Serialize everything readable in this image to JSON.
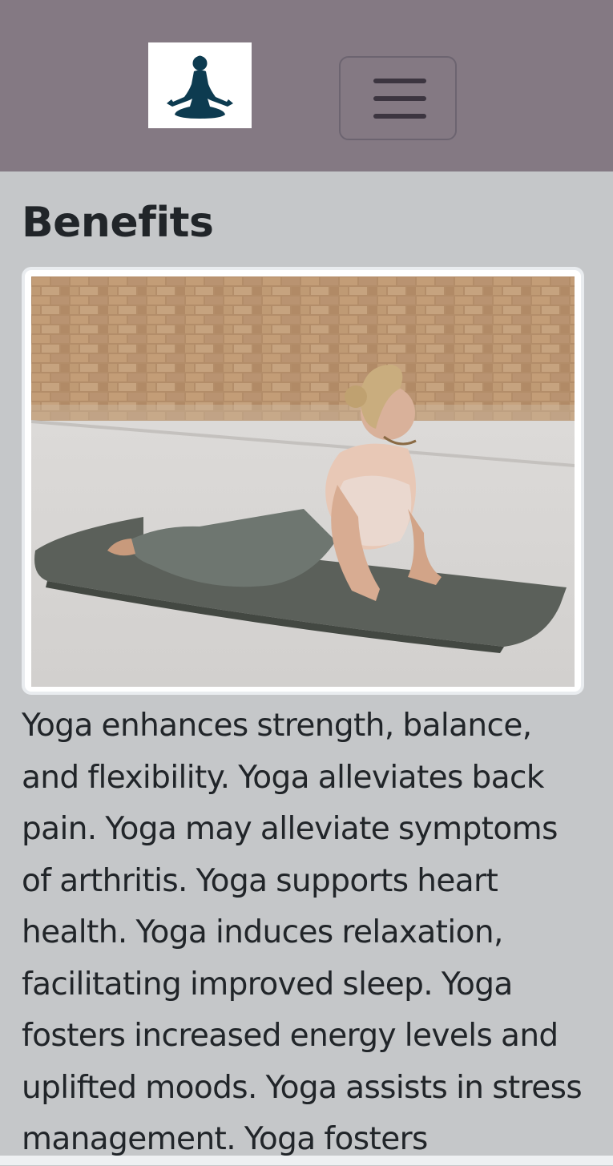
{
  "navbar": {
    "logo_icon": "meditation-pose-icon",
    "toggler_icon": "hamburger-menu-icon",
    "background_color": "#847983"
  },
  "main": {
    "title": "Benefits",
    "image_icon": "yoga-cobra-pose-photo",
    "benefits_text": "Yoga enhances strength, balance, and flexibility. Yoga alleviates back pain. Yoga may alleviate symptoms of arthritis. Yoga supports heart health. Yoga induces relaxation, facilitating improved sleep. Yoga fosters increased energy levels and uplifted moods. Yoga assists in stress management. Yoga fosters",
    "background_color": "#c5c7c9"
  }
}
